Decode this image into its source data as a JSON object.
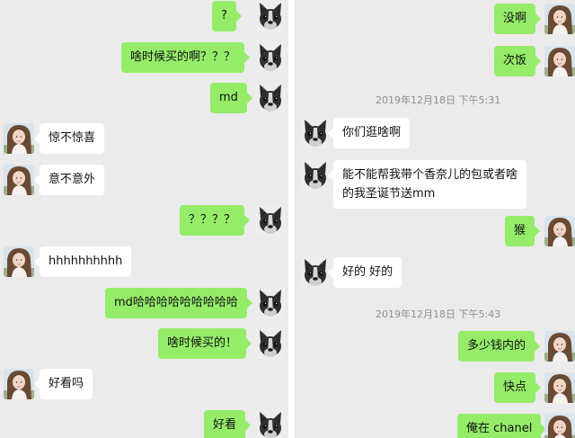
{
  "left_panel": {
    "messages": [
      {
        "side": "out",
        "text": "?"
      },
      {
        "side": "out",
        "text": "啥时候买的啊？？？"
      },
      {
        "side": "out",
        "text": "md"
      },
      {
        "side": "in",
        "text": "惊不惊喜"
      },
      {
        "side": "in",
        "text": "意不意外"
      },
      {
        "side": "out",
        "text": "？？？？"
      },
      {
        "side": "in",
        "text": "hhhhhhhhhh"
      },
      {
        "side": "out",
        "text": "md哈哈哈哈哈哈哈哈哈"
      },
      {
        "side": "out",
        "text": "啥时候买的！"
      },
      {
        "side": "in",
        "text": "好看吗"
      },
      {
        "side": "out",
        "text": "好看"
      }
    ]
  },
  "right_panel": {
    "messages": [
      {
        "side": "out",
        "text": "没啊"
      },
      {
        "side": "out",
        "text": "次饭"
      },
      {
        "side": "in",
        "text": "你们逛啥啊"
      },
      {
        "side": "in",
        "lines": [
          "能不能帮我带个香奈儿的包或者啥",
          "的我圣诞节送mm"
        ]
      },
      {
        "side": "out",
        "text": "猴"
      },
      {
        "side": "in",
        "text": "好的 好的"
      },
      {
        "side": "out",
        "text": "多少钱内的"
      },
      {
        "side": "out",
        "text": "快点"
      },
      {
        "side": "out",
        "text": "俺在 chanel"
      }
    ],
    "timestamps": [
      "2019年12月18日 下午5:31",
      "2019年12月18日 下午5:43"
    ]
  },
  "avatars": {
    "self": "french-bulldog-avatar",
    "other": "girl-photo-avatar"
  },
  "colors": {
    "outgoing_bubble": "#95ec69",
    "incoming_bubble": "#ffffff",
    "chat_background": "#ebebeb",
    "timestamp_text": "#8f8f8f"
  }
}
